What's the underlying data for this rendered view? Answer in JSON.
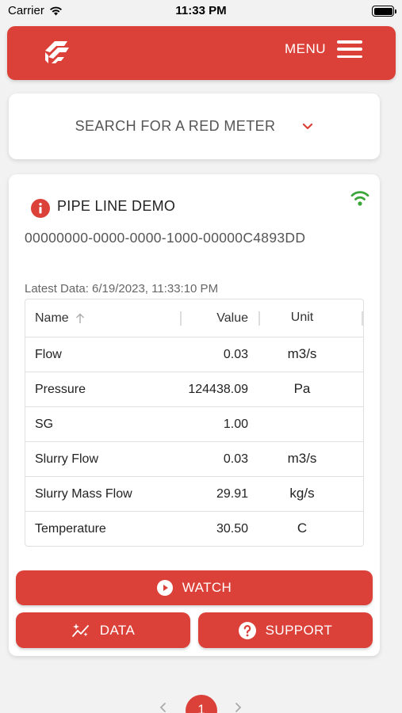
{
  "status_bar": {
    "carrier": "Carrier",
    "time": "11:33 PM"
  },
  "header": {
    "menu_label": "MENU"
  },
  "search": {
    "label": "SEARCH FOR A RED METER"
  },
  "meter": {
    "name": "PIPE LINE DEMO",
    "id": "00000000-0000-0000-1000-00000C4893DD",
    "latest_data": "Latest Data: 6/19/2023, 11:33:10 PM",
    "table": {
      "headers": {
        "name": "Name",
        "value": "Value",
        "unit": "Unit"
      },
      "rows": [
        {
          "name": "Flow",
          "value": "0.03",
          "unit": "m3/s"
        },
        {
          "name": "Pressure",
          "value": "124438.09",
          "unit": "Pa"
        },
        {
          "name": "SG",
          "value": "1.00",
          "unit": ""
        },
        {
          "name": "Slurry Flow",
          "value": "0.03",
          "unit": "m3/s"
        },
        {
          "name": "Slurry Mass Flow",
          "value": "29.91",
          "unit": "kg/s"
        },
        {
          "name": "Temperature",
          "value": "30.50",
          "unit": "C"
        }
      ]
    }
  },
  "actions": {
    "watch": "WATCH",
    "data": "DATA",
    "support": "SUPPORT"
  },
  "pagination": {
    "current": "1"
  },
  "colors": {
    "brand": "#db4139",
    "signal": "#3aa63a"
  },
  "icons": [
    "logo-icon",
    "hamburger-menu-icon",
    "chevron-down-icon",
    "info-icon",
    "wifi-signal-icon",
    "sort-arrow-up-icon",
    "play-icon",
    "sparkle-chart-icon",
    "help-icon",
    "chevron-left-icon",
    "chevron-right-icon"
  ]
}
